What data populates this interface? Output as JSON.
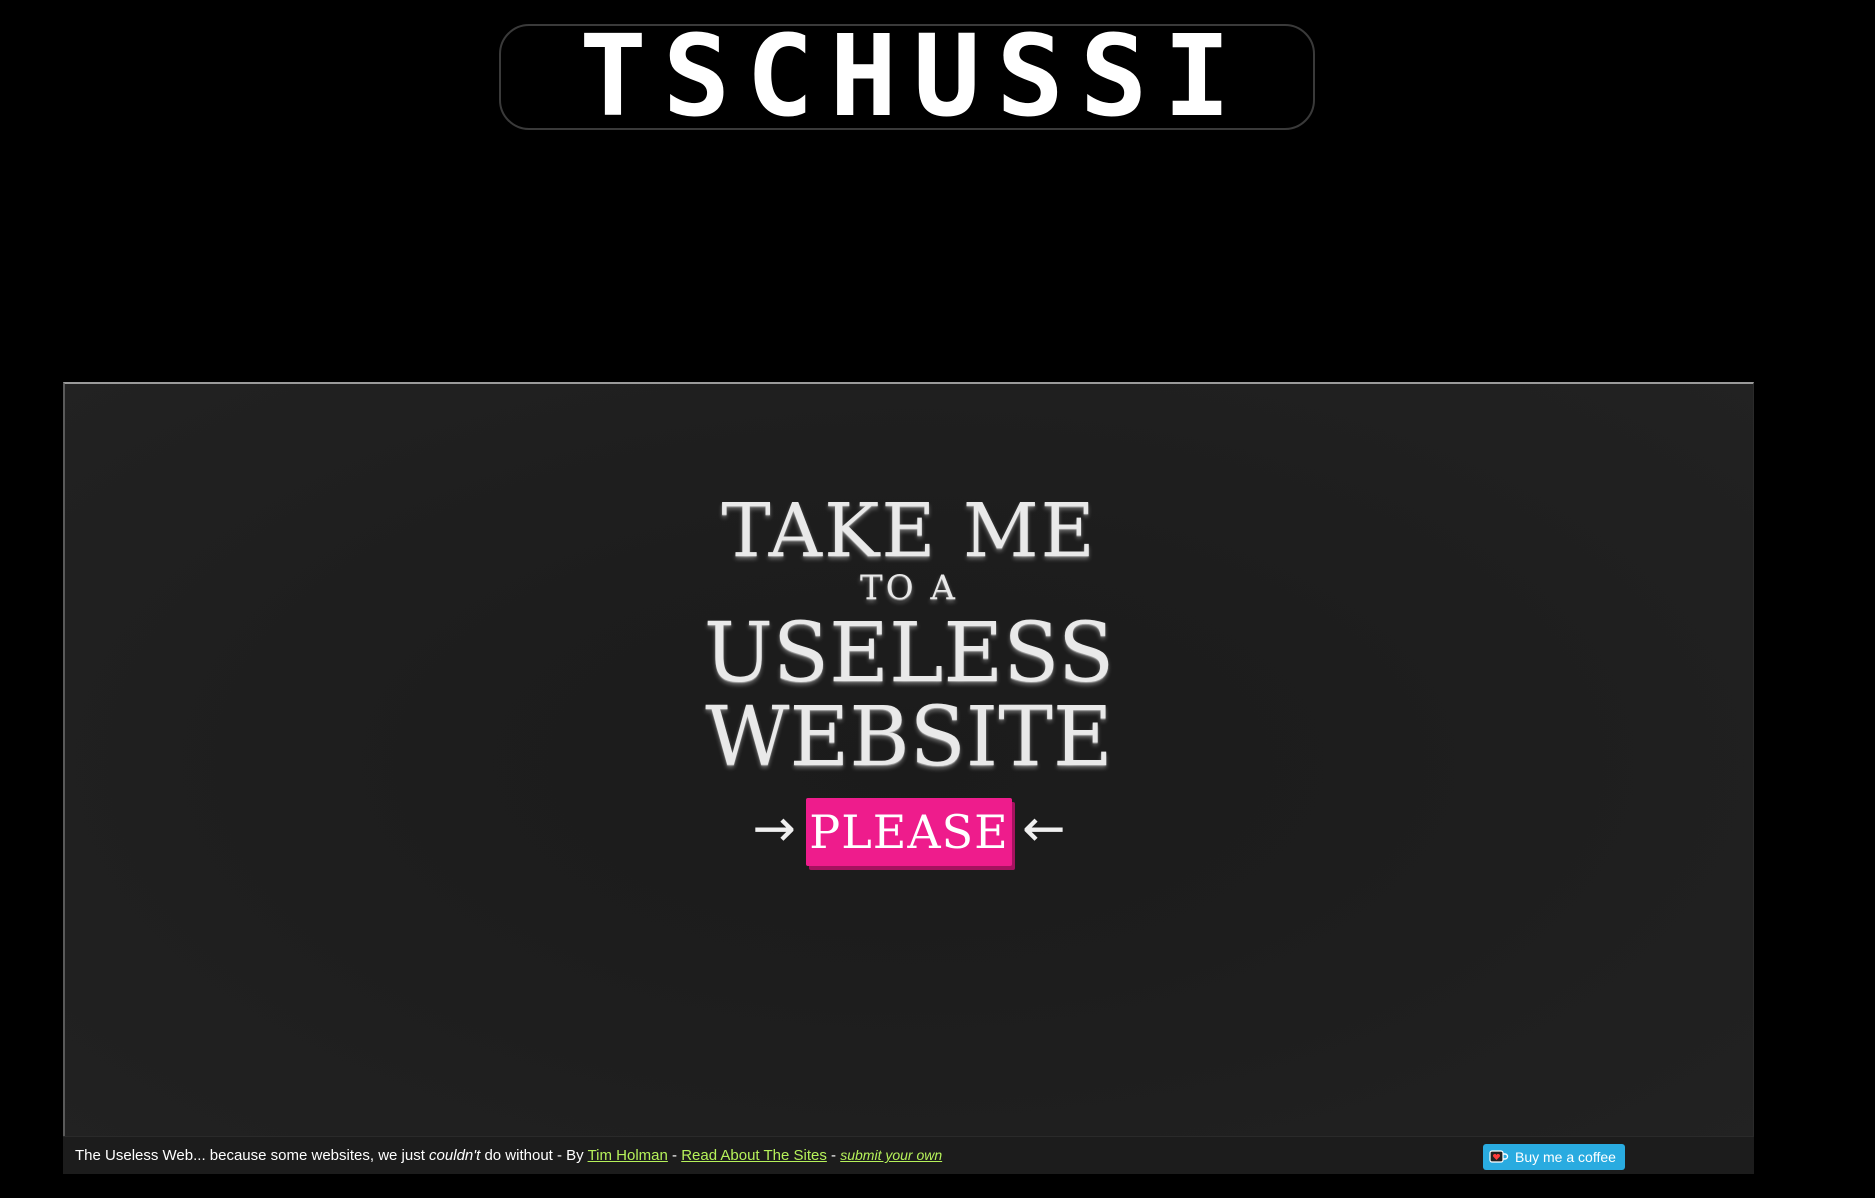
{
  "logo": {
    "text": "TSCHÜSSI"
  },
  "hero": {
    "line1": "TAKE ME",
    "line2": "TO A",
    "line3": "USELESS",
    "line4": "WEBSITE",
    "button_label": "PLEASE",
    "arrow_left": "→",
    "arrow_right": "←"
  },
  "footer": {
    "text_start": "The Useless Web... because some websites, we just ",
    "text_emphasis": "couldn't",
    "text_middle": " do without - By ",
    "author_link": "Tim Holman",
    "separator1": " - ",
    "about_link": "Read About The Sites",
    "separator2": " - ",
    "submit_link": "submit your own",
    "coffee_label": "Buy me a coffee"
  },
  "colors": {
    "accent_pink": "#ee1c8c",
    "link_green": "#b6f25a",
    "coffee_blue": "#29abe0"
  }
}
